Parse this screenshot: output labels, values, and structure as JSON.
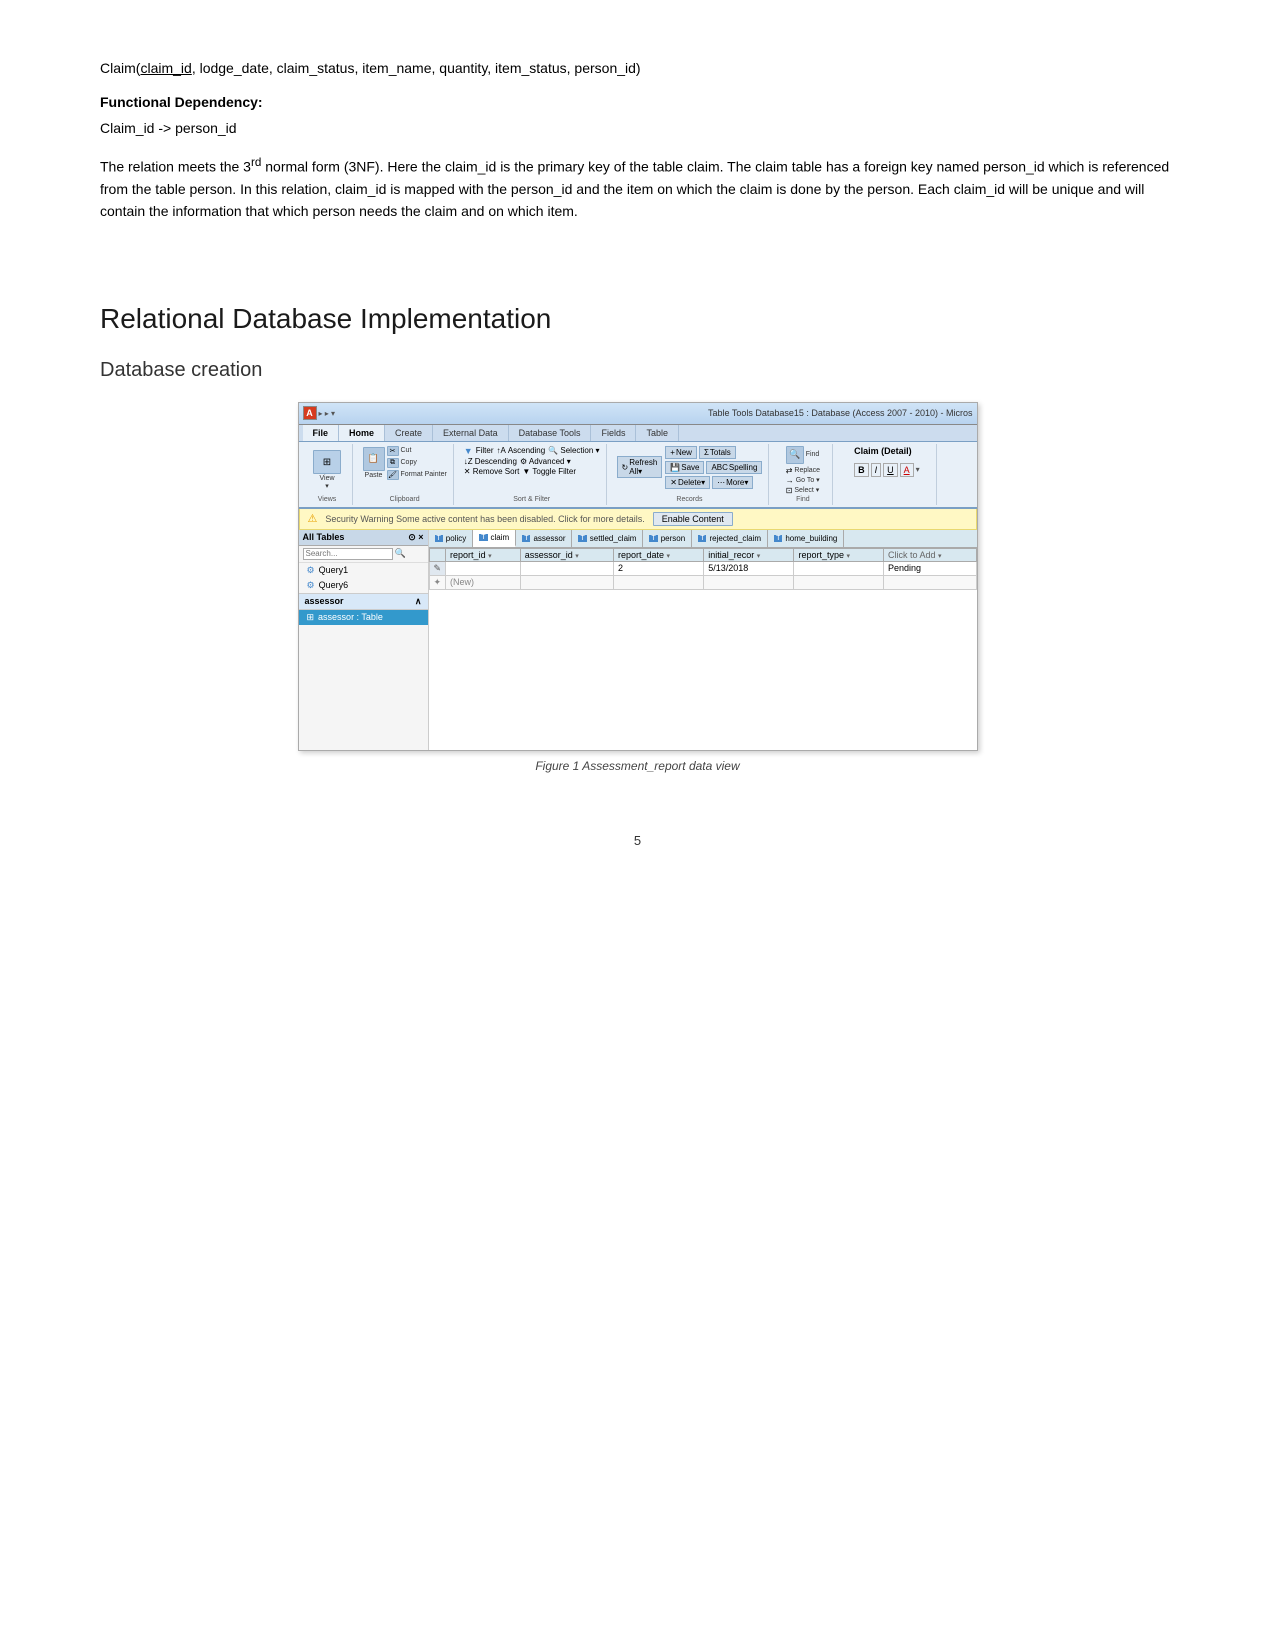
{
  "claim_line": {
    "text": "Claim(",
    "underlined": "claim_id",
    "rest": ", lodge_date, claim_status, item_name, quantity, item_status, person_id)"
  },
  "functional_dep": {
    "label": "Functional Dependency:",
    "value": "Claim_id -> person_id"
  },
  "description": "The relation meets the 3rd normal form (3NF). Here the claim_id is the primary key of the table claim. The claim table has a foreign key named person_id which is referenced from the table person. In this relation, claim_id is mapped with the person_id and the item on which the claim is done by the person. Each claim_id will be unique and will contain the information that which person needs the claim and on which item.",
  "section_heading": "Relational Database Implementation",
  "sub_heading": "Database creation",
  "access": {
    "title_bar": {
      "icon": "A",
      "app_info": "Table Tools   Database15 : Database (Access 2007 - 2010) - Micros",
      "quick_access": "▸ ▸ ▾"
    },
    "ribbon": {
      "tabs": [
        "File",
        "Home",
        "Create",
        "External Data",
        "Database Tools",
        "Fields",
        "Table"
      ],
      "active_tab": "Home",
      "groups": {
        "views": {
          "label": "Views",
          "btn_label": "View"
        },
        "clipboard": {
          "label": "Clipboard",
          "btns": [
            "Cut",
            "Copy",
            "Format Painter",
            "Paste"
          ]
        },
        "sort_filter": {
          "label": "Sort & Filter",
          "btns": [
            "Ascending",
            "Descending",
            "Remove Sort",
            "Selection",
            "Advanced",
            "Toggle Filter",
            "Filter"
          ]
        },
        "records": {
          "label": "Records",
          "btns": [
            "New",
            "Save",
            "Delete",
            "Refresh All",
            "Totals",
            "Spelling",
            "More"
          ]
        },
        "find": {
          "label": "Find",
          "btns": [
            "Find",
            "Replace",
            "Go To",
            "Select"
          ]
        },
        "formatting": {
          "label": "",
          "btns": [
            "B",
            "I",
            "U",
            "A"
          ],
          "claim_detail": "Claim (Detail)"
        }
      }
    },
    "security_warning": {
      "icon": "!",
      "text": "Security Warning   Some active content has been disabled. Click for more details.",
      "btn": "Enable Content"
    },
    "nav_pane": {
      "header": "All Tables",
      "search_placeholder": "Search...",
      "items": [
        {
          "type": "query",
          "label": "Query1"
        },
        {
          "type": "query",
          "label": "Query6"
        }
      ],
      "sections": [
        {
          "label": "assessor",
          "items": [
            "assessor : Table"
          ]
        }
      ]
    },
    "table_tabs": [
      {
        "icon": "T",
        "label": "policy"
      },
      {
        "icon": "T",
        "label": "claim",
        "active": true
      },
      {
        "icon": "T",
        "label": "assessor"
      },
      {
        "icon": "T",
        "label": "settled_claim"
      },
      {
        "icon": "T",
        "label": "person"
      },
      {
        "icon": "T",
        "label": "rejected_claim"
      },
      {
        "icon": "T",
        "label": "home_building"
      }
    ],
    "table": {
      "columns": [
        "report_id",
        "assessor_id",
        "report_date",
        "initial_record",
        "report_type",
        "Click to Add"
      ],
      "rows": [
        {
          "selector": "*",
          "report_id": "",
          "assessor_id": "",
          "report_date": "2",
          "initial_record": "5/13/2018",
          "report_type": "",
          "click_to_add": "Pending"
        },
        {
          "selector": "*",
          "report_id": "(New)",
          "assessor_id": "",
          "report_date": "",
          "initial_record": "",
          "report_type": "",
          "click_to_add": ""
        }
      ]
    }
  },
  "figure_caption": "Figure 1 Assessment_report data view",
  "page_number": "5"
}
